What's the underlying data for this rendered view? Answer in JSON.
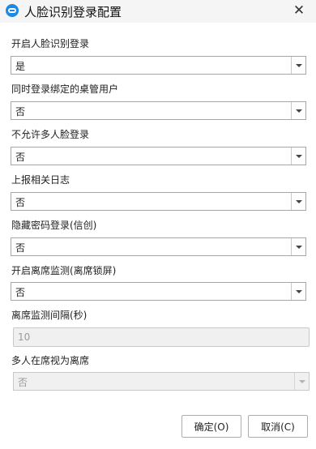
{
  "window": {
    "title": "人脸识别登录配置",
    "close_glyph": "✕"
  },
  "fields": [
    {
      "label": "开启人脸识别登录",
      "value": "是",
      "disabled": false
    },
    {
      "label": "同时登录绑定的桌管用户",
      "value": "否",
      "disabled": false
    },
    {
      "label": "不允许多人脸登录",
      "value": "否",
      "disabled": false
    },
    {
      "label": "上报相关日志",
      "value": "否",
      "disabled": false
    },
    {
      "label": "隐藏密码登录(信创)",
      "value": "否",
      "disabled": false
    },
    {
      "label": "开启离席监测(离席锁屏)",
      "value": "否",
      "disabled": false
    }
  ],
  "interval": {
    "label": "离席监测间隔(秒)",
    "value": "10"
  },
  "multi_person": {
    "label": "多人在席视为离席",
    "value": "否"
  },
  "buttons": {
    "ok": "确定(O)",
    "cancel": "取消(C)"
  }
}
